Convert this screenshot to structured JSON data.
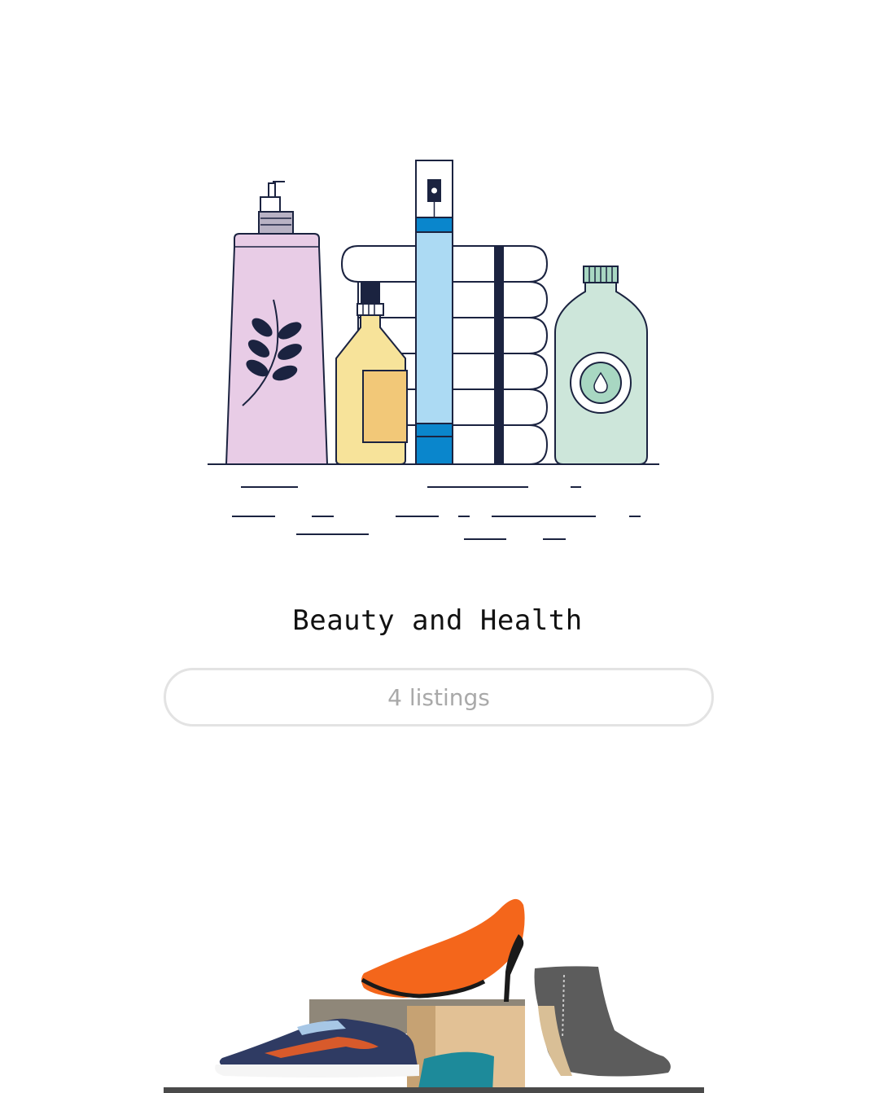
{
  "categories": [
    {
      "title": "Beauty and Health",
      "listings_label": "4 listings",
      "image_icon": "beauty-products-illustration"
    },
    {
      "title": "",
      "listings_label": "",
      "image_icon": "shoes-illustration"
    }
  ],
  "colors": {
    "pill_border": "#e3e3e3",
    "pill_text": "#a9a9a9",
    "title_text": "#111111",
    "bottle_pink": "#e8cce6",
    "bottle_yellow": "#f7e39a",
    "bottle_blue": "#acdaf3",
    "bottle_green": "#cde6da",
    "heel_orange": "#f4661b",
    "boot_gray": "#5c5c5c"
  }
}
